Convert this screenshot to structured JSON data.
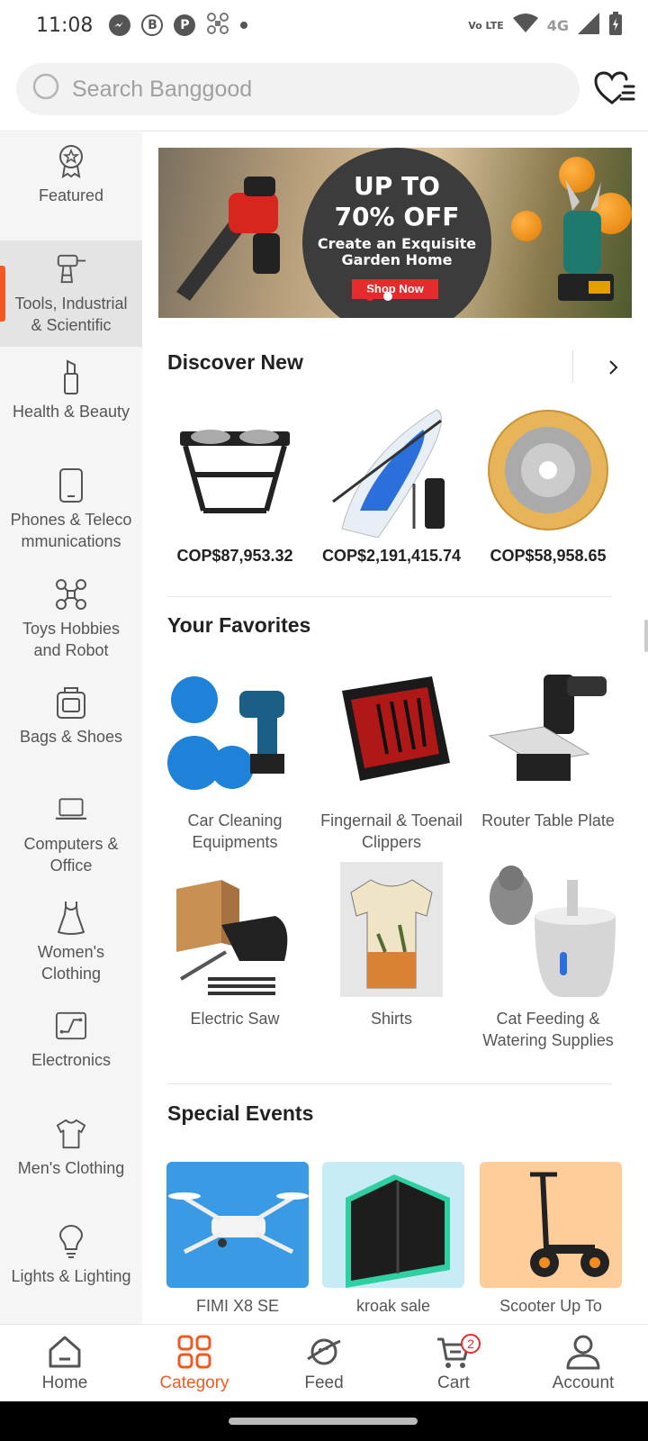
{
  "status_bar": {
    "time": "11:08",
    "network_label": "4G",
    "lte_label": "Vo LTE"
  },
  "search": {
    "placeholder": "Search Banggood"
  },
  "sidebar": {
    "items": [
      {
        "label": "Featured",
        "icon": "featured-badge-icon"
      },
      {
        "label": "Tools, Industrial & Scientific",
        "icon": "drill-icon",
        "active": true
      },
      {
        "label": "Health & Beauty",
        "icon": "lipstick-icon"
      },
      {
        "label": "Phones & Telecommunications",
        "icon": "phone-icon"
      },
      {
        "label": "Toys Hobbies and Robot",
        "icon": "drone-icon"
      },
      {
        "label": "Bags & Shoes",
        "icon": "bag-icon"
      },
      {
        "label": "Computers & Office",
        "icon": "laptop-icon"
      },
      {
        "label": "Women's Clothing",
        "icon": "dress-icon"
      },
      {
        "label": "Electronics",
        "icon": "circuit-icon"
      },
      {
        "label": "Men's Clothing",
        "icon": "tshirt-icon"
      },
      {
        "label": "Lights & Lighting",
        "icon": "bulb-icon"
      }
    ]
  },
  "banner": {
    "line1": "UP TO",
    "line2": "70% OFF",
    "line3": "Create an Exquisite Garden Home",
    "cta": "Shop Now",
    "slide_count": 2,
    "active_slide": 1
  },
  "discover": {
    "title": "Discover New",
    "products": [
      {
        "price": "COP$87,953.32",
        "name": "elevated-pet-bowl-stand"
      },
      {
        "price": "COP$2,191,415.74",
        "name": "inflatable-paddle-board"
      },
      {
        "price": "COP$58,958.65",
        "name": "circular-saw-blade"
      }
    ]
  },
  "favorites": {
    "title": "Your Favorites",
    "items": [
      {
        "label": "Car Cleaning Equipments"
      },
      {
        "label": "Fingernail & Toenail Clippers"
      },
      {
        "label": "Router Table Plate"
      },
      {
        "label": "Electric Saw"
      },
      {
        "label": "Shirts"
      },
      {
        "label": "Cat Feeding & Watering Supplies"
      }
    ]
  },
  "special_events": {
    "title": "Special Events",
    "items": [
      {
        "label": "FIMI X8 SE",
        "bg": "#3a9be4"
      },
      {
        "label": "kroak sale",
        "bg": "#c8ecf6"
      },
      {
        "label": "Scooter Up To",
        "bg": "#ffcd99"
      }
    ]
  },
  "bottom_nav": {
    "items": [
      {
        "label": "Home",
        "icon": "home-icon"
      },
      {
        "label": "Category",
        "icon": "category-grid-icon",
        "active": true
      },
      {
        "label": "Feed",
        "icon": "planet-icon"
      },
      {
        "label": "Cart",
        "icon": "cart-icon",
        "badge": "2"
      },
      {
        "label": "Account",
        "icon": "account-icon"
      }
    ]
  },
  "colors": {
    "accent": "#f05a22",
    "sidebar_bg": "#f5f5f5",
    "active_item_bg": "#e4e4e4",
    "sale_red": "#e52b2b"
  }
}
